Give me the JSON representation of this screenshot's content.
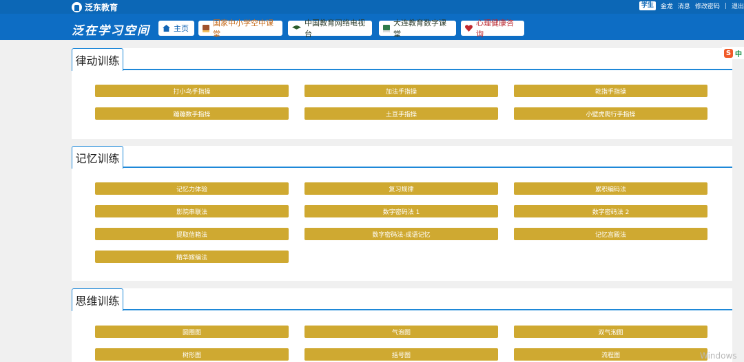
{
  "topbar": {
    "brand": "泛东教育",
    "role": "学生",
    "user_name": "金龙",
    "messages": "消息",
    "change_password": "修改密码",
    "separator": "|",
    "logout": "退出"
  },
  "navbar": {
    "site_title": "泛在学习空间",
    "links": [
      {
        "label": "主页",
        "icon": "home-icon"
      },
      {
        "label": "国家中小学空中课堂",
        "icon": "book-icon"
      },
      {
        "label": "中国教育网络电视台",
        "icon": "graduation-cap-icon"
      },
      {
        "label": "大连教育数字课堂",
        "icon": "book-icon"
      },
      {
        "label": "心理健康咨询",
        "icon": "heart-icon"
      }
    ]
  },
  "sections": [
    {
      "title": "律动训练",
      "buttons": [
        "打小鸟手指操",
        "加法手指操",
        "乾指手指操",
        "蹦蹦数手指操",
        "土豆手指操",
        "小壁虎爬行手指操"
      ]
    },
    {
      "title": "记忆训练",
      "buttons": [
        "记忆力体验",
        "复习规律",
        "累积编码法",
        "影院串联法",
        "数字密码法 1",
        "数字密码法 2",
        "提取信箱法",
        "数字密码法-成语记忆",
        "记忆宫殿法",
        "精华嫁编法"
      ]
    },
    {
      "title": "思维训练",
      "buttons": [
        "圆圈图",
        "气泡图",
        "双气泡图",
        "树形图",
        "括号图",
        "流程图"
      ]
    }
  ],
  "ime": {
    "brand_glyph": "S",
    "mode": "中"
  },
  "watermark": "Windows",
  "colors": {
    "topbar": "#0c67b6",
    "navbar": "#0d6dc4",
    "button": "#cfa931",
    "accent_line": "#1e88d8"
  }
}
